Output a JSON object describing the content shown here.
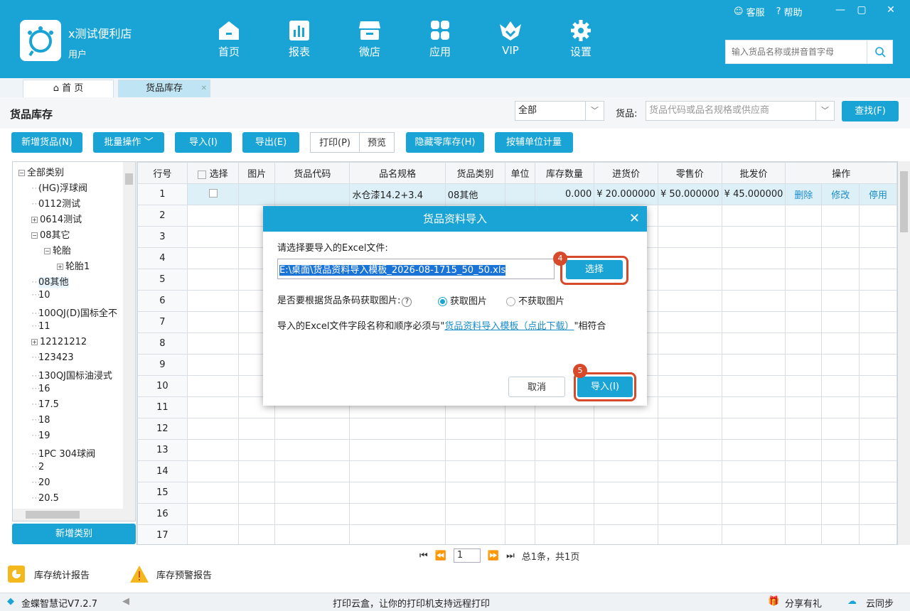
{
  "header": {
    "shop_name": "x测试便利店",
    "user": "用户",
    "help_links": [
      "客服",
      "帮助"
    ],
    "window_controls": [
      "—",
      "▢",
      "✕"
    ],
    "nav": [
      {
        "label": "首页",
        "icon": "home-icon"
      },
      {
        "label": "报表",
        "icon": "report-icon"
      },
      {
        "label": "微店",
        "icon": "shop-icon"
      },
      {
        "label": "应用",
        "icon": "apps-icon"
      },
      {
        "label": "VIP",
        "icon": "vip-icon"
      },
      {
        "label": "设置",
        "icon": "gear-icon"
      }
    ],
    "search_placeholder": "输入货品名称或拼音首字母"
  },
  "tabs": [
    {
      "label": "首 页",
      "icon": "home-outline-icon"
    },
    {
      "label": "货品库存",
      "close": "✕"
    }
  ],
  "page": {
    "title": "货品库存",
    "category_select": "全部",
    "goods_label": "货品:",
    "goods_placeholder": "货品代码或品名规格或供应商",
    "find_button": "查找(F)"
  },
  "toolbar": {
    "add": "新增货品(N)",
    "batch": "批量操作",
    "import": "导入(I)",
    "export": "导出(E)",
    "print": "打印(P)",
    "preview": "预览",
    "hide_zero": "隐藏零库存(H)",
    "unit_measure": "按辅单位计量"
  },
  "tree": {
    "items": [
      {
        "t": "全部类别",
        "lvl": 0,
        "pm": "−"
      },
      {
        "t": "(HG)浮球阀",
        "lvl": 1
      },
      {
        "t": "0112测试",
        "lvl": 1
      },
      {
        "t": "0614测试",
        "lvl": 1,
        "pm": "+"
      },
      {
        "t": "08其它",
        "lvl": 1,
        "pm": "−"
      },
      {
        "t": "轮胎",
        "lvl": 2,
        "pm": "−"
      },
      {
        "t": "轮胎1",
        "lvl": 3,
        "pm": "+"
      },
      {
        "t": "08其他",
        "lvl": 1
      },
      {
        "t": "10",
        "lvl": 1
      },
      {
        "t": "100QJ(D)国标全不",
        "lvl": 1
      },
      {
        "t": "11",
        "lvl": 1
      },
      {
        "t": "12121212",
        "lvl": 1,
        "pm": "+"
      },
      {
        "t": "123423",
        "lvl": 1
      },
      {
        "t": "130QJ国标油浸式",
        "lvl": 1
      },
      {
        "t": "16",
        "lvl": 1
      },
      {
        "t": "17.5",
        "lvl": 1
      },
      {
        "t": "18",
        "lvl": 1
      },
      {
        "t": "19",
        "lvl": 1
      },
      {
        "t": "1PC 304球阀",
        "lvl": 1
      },
      {
        "t": "2",
        "lvl": 1
      },
      {
        "t": "20",
        "lvl": 1
      },
      {
        "t": "20.5",
        "lvl": 1
      }
    ],
    "add_category": "新增类别"
  },
  "table": {
    "headers": [
      "行号",
      "选择",
      "图片",
      "货品代码",
      "品名规格",
      "货品类别",
      "单位",
      "库存数量",
      "进货价",
      "零售价",
      "批发价",
      "操作"
    ],
    "row1": {
      "num": "1",
      "name": "水仓漆14.2+3.4",
      "category": "08其他",
      "stock": "0.000",
      "purchase": "¥ 20.000000",
      "retail": "¥ 50.000000",
      "wholesale": "¥ 45.000000",
      "ops": [
        "删除",
        "修改",
        "停用"
      ]
    },
    "row_numbers": [
      "2",
      "3",
      "4",
      "5",
      "6",
      "7",
      "8",
      "9",
      "10",
      "11",
      "12",
      "13",
      "14",
      "15",
      "16",
      "17"
    ]
  },
  "dialog": {
    "title": "货品资料导入",
    "prompt": "请选择要导入的Excel文件:",
    "file_path": "E:\\桌面\\货品资料导入模板_2026-08-1715_50_50.xls",
    "choose": "选择",
    "image_question": "是否要根据货品条码获取图片:",
    "get_image": "获取图片",
    "no_image": "不获取图片",
    "note_prefix": "导入的Excel文件字段名称和顺序必须与\"",
    "note_link": "货品资料导入模板（点此下载）",
    "note_suffix": "\"相符合",
    "cancel": "取消",
    "import": "导入(I)",
    "step_choose": "4",
    "step_import": "5"
  },
  "pager": {
    "page": "1",
    "summary": "总1条，共1页"
  },
  "reports": [
    "库存统计报告",
    "库存预警报告"
  ],
  "status": {
    "version": "金蝶智慧记V7.2.7",
    "ad": "打印云盒，让你的打印机支持远程打印",
    "share": "分享有礼",
    "sync": "云同步"
  }
}
